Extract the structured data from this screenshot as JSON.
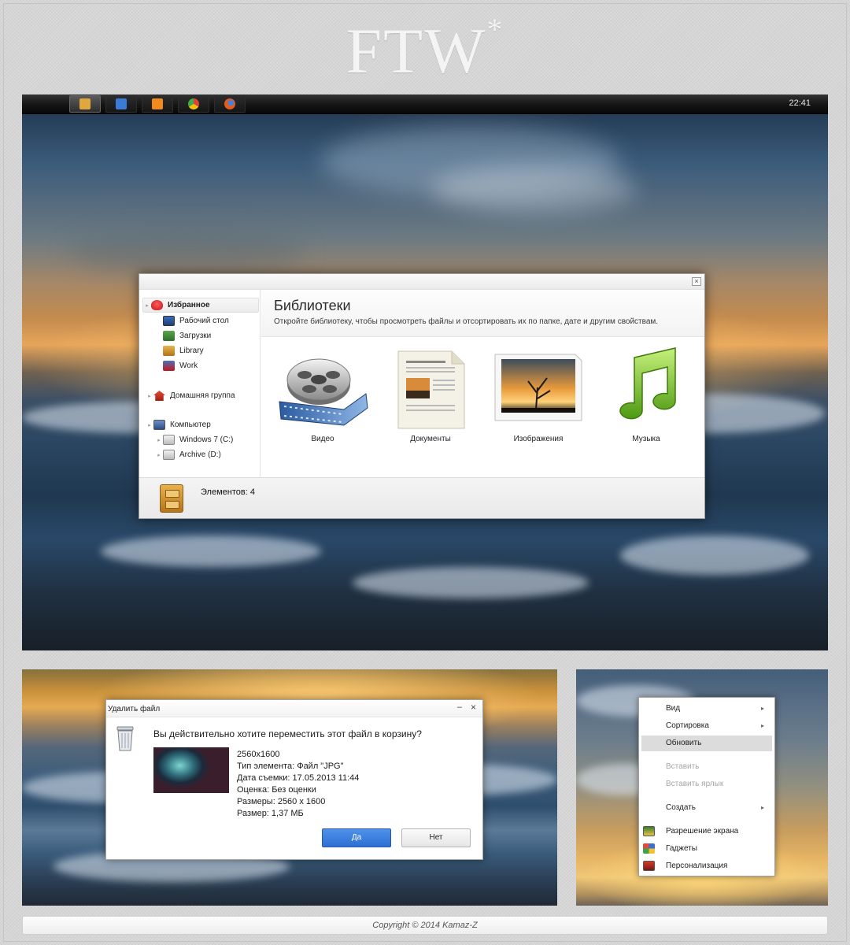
{
  "logo": {
    "text": "FTW",
    "mark": "*"
  },
  "taskbar": {
    "items": [
      {
        "icon": "library-cabinet-icon",
        "color": "#e0a640",
        "active": true
      },
      {
        "icon": "notepad-icon",
        "color": "#3a7bd5",
        "active": false
      },
      {
        "icon": "music-player-icon",
        "color": "#f08a1e",
        "active": false
      },
      {
        "icon": "chrome-icon",
        "color": "#3fae49",
        "active": false
      },
      {
        "icon": "firefox-icon",
        "color": "#e55b1a",
        "active": false
      }
    ],
    "clock": "22:41"
  },
  "explorer": {
    "nav": {
      "favorites": "Избранное",
      "desktop": "Рабочий стол",
      "downloads": "Загрузки",
      "library": "Library",
      "work": "Work",
      "homegroup": "Домашняя группа",
      "computer": "Компьютер",
      "drive_c": "Windows 7 (C:)",
      "drive_d": "Archive (D:)"
    },
    "title": "Библиотеки",
    "subtitle": "Откройте библиотеку, чтобы просмотреть файлы и отсортировать их по папке, дате и другим свойствам.",
    "libraries": [
      {
        "label": "Видео",
        "icon": "video-reel-icon"
      },
      {
        "label": "Документы",
        "icon": "documents-icon"
      },
      {
        "label": "Изображения",
        "icon": "pictures-icon"
      },
      {
        "label": "Музыка",
        "icon": "music-note-icon"
      }
    ],
    "status": "Элементов: 4"
  },
  "delete_dialog": {
    "title": "Удалить файл",
    "question": "Вы действительно хотите переместить этот файл в корзину?",
    "info": [
      "2560x1600",
      "Тип элемента: Файл \"JPG\"",
      "Дата съемки: 17.05.2013 11:44",
      "Оценка: Без оценки",
      "Размеры: 2560 x 1600",
      "Размер: 1,37 МБ"
    ],
    "yes": "Да",
    "no": "Нет"
  },
  "context_menu": {
    "view": "Вид",
    "sort": "Сортировка",
    "refresh": "Обновить",
    "paste": "Вставить",
    "paste_shortcut": "Вставить ярлык",
    "new": "Создать",
    "resolution": "Разрешение экрана",
    "gadgets": "Гаджеты",
    "personalize": "Персонализация"
  },
  "footer": {
    "copyright": "Copyright © 2014 Kamaz-Z"
  }
}
